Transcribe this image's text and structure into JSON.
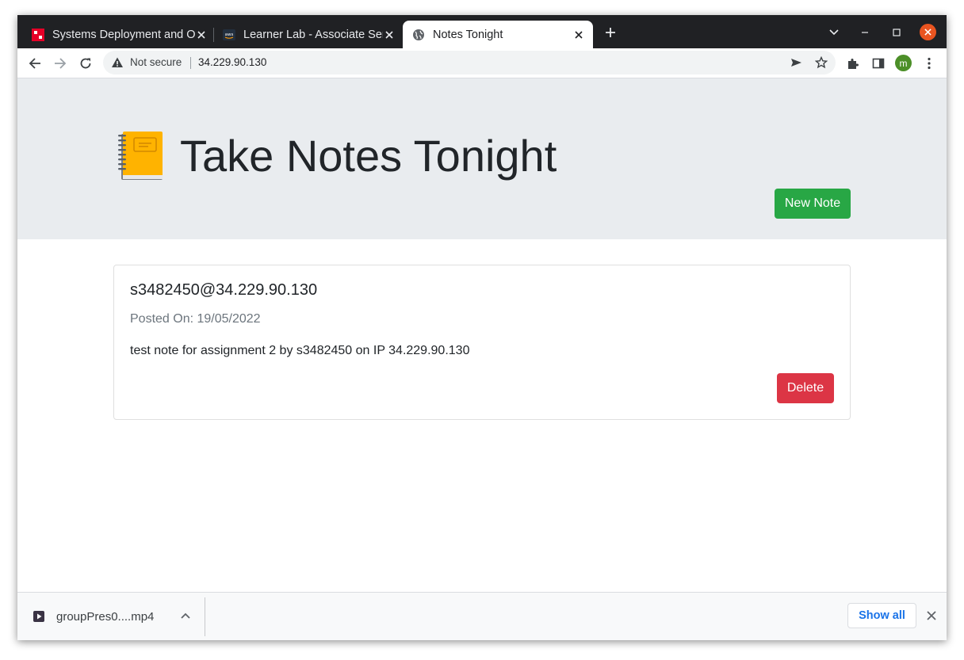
{
  "browser": {
    "tabs": [
      {
        "title": "Systems Deployment and Operations",
        "active": false
      },
      {
        "title": "Learner Lab - Associate Services",
        "active": false
      },
      {
        "title": "Notes Tonight",
        "active": true
      }
    ],
    "address": {
      "security_label": "Not secure",
      "url": "34.229.90.130"
    },
    "profile_initial": "m"
  },
  "page": {
    "heading": "Take Notes Tonight",
    "new_note_label": "New Note",
    "notes": [
      {
        "title": "s3482450@34.229.90.130",
        "posted_label": "Posted On: ",
        "posted_date": "19/05/2022",
        "body": "test note for assignment 2 by s3482450 on IP 34.229.90.130",
        "delete_label": "Delete"
      }
    ]
  },
  "downloads": {
    "file_name": "groupPres0....mp4",
    "show_all_label": "Show all"
  },
  "colors": {
    "tabstrip": "#202124",
    "jumbotron": "#e9ecef",
    "success": "#28a745",
    "danger": "#dc3545",
    "link": "#1a73e8"
  }
}
